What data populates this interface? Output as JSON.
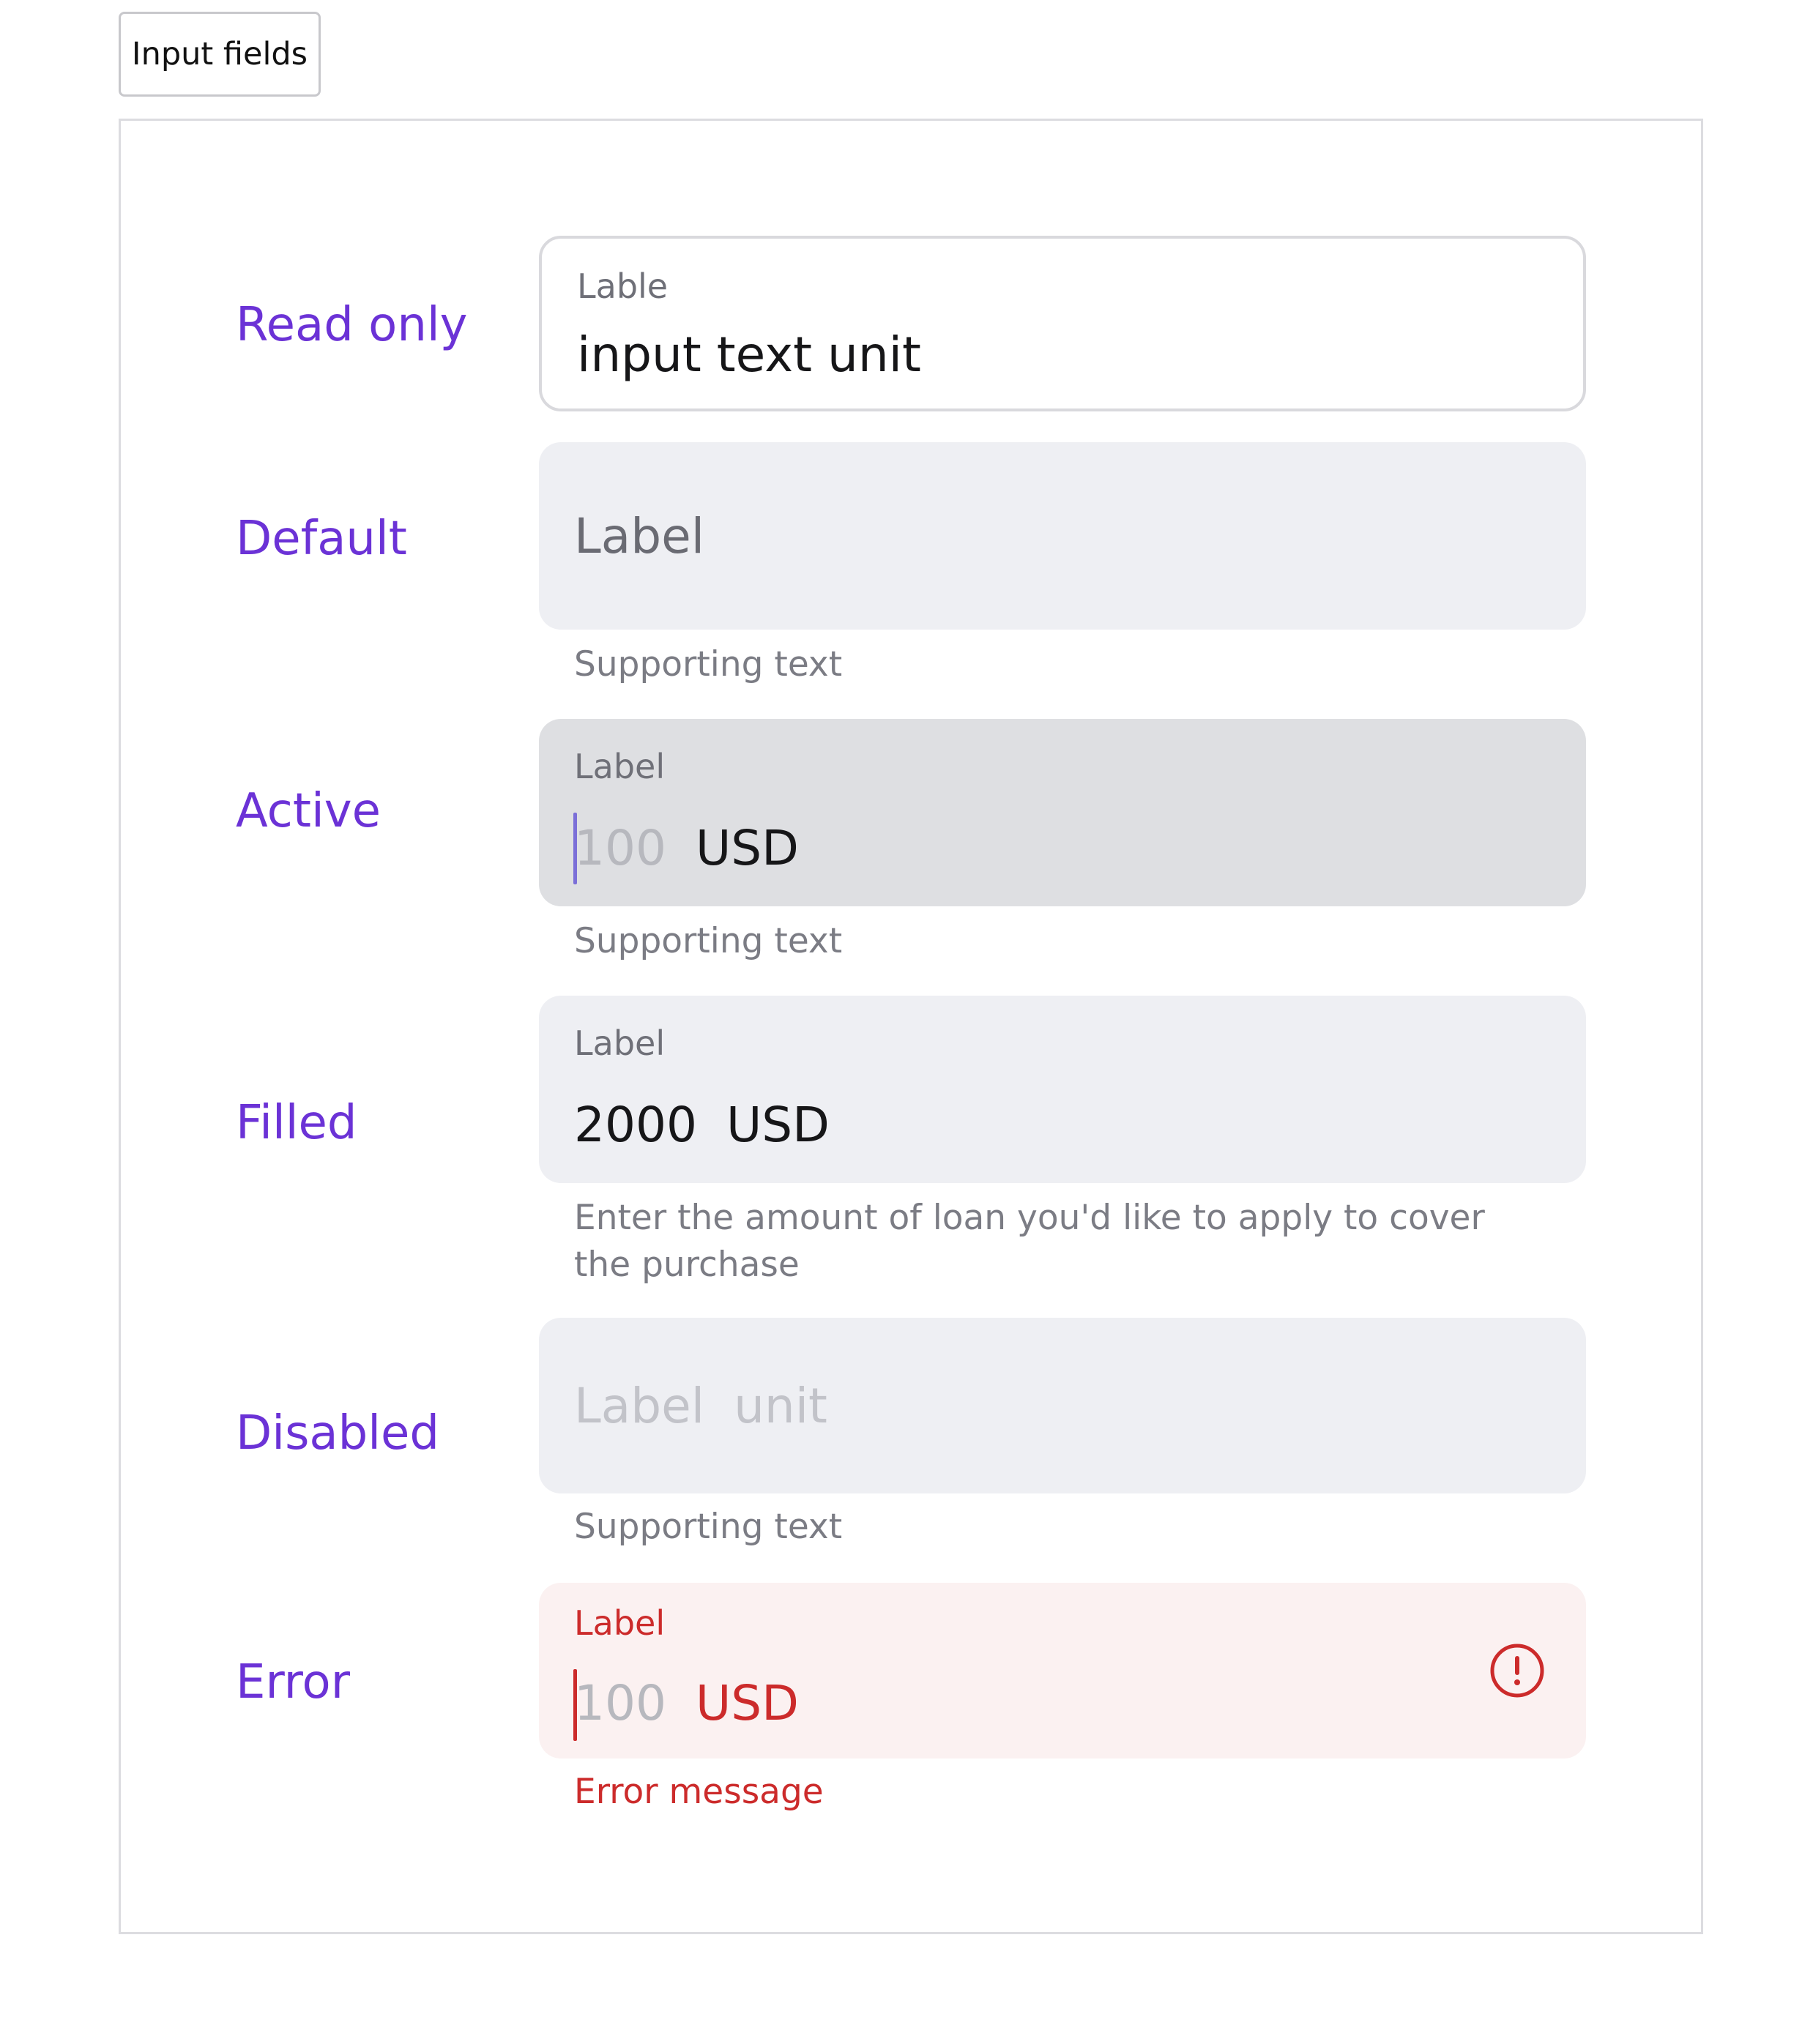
{
  "tab": {
    "label": "Input fields"
  },
  "rows": {
    "read_only": {
      "state_label": "Read only",
      "field_label": "Lable",
      "value": "input text unit"
    },
    "default": {
      "state_label": "Default",
      "placeholder": "Label",
      "supporting_text": "Supporting text"
    },
    "active": {
      "state_label": "Active",
      "field_label": "Label",
      "placeholder": "100",
      "unit": "USD",
      "supporting_text": "Supporting text"
    },
    "filled": {
      "state_label": "Filled",
      "field_label": "Label",
      "value": "2000",
      "unit": "USD",
      "supporting_text_line1": "Enter the amount of loan you'd like to apply to cover",
      "supporting_text_line2": "the purchase"
    },
    "disabled": {
      "state_label": "Disabled",
      "placeholder": "Label",
      "unit": "unit",
      "supporting_text": "Supporting text"
    },
    "error": {
      "state_label": "Error",
      "field_label": "Label",
      "placeholder": "100",
      "unit": "USD",
      "error_message": "Error message",
      "icon": "alert-circle-icon"
    }
  },
  "colors": {
    "state_label": "#6b32d6",
    "field_bg": "#eeeff3",
    "active_bg": "#dedfe2",
    "error_bg": "#fbf1f1",
    "error": "#cc2b2b",
    "active_caret": "#7b6fd8",
    "placeholder": "#b7b8be"
  }
}
